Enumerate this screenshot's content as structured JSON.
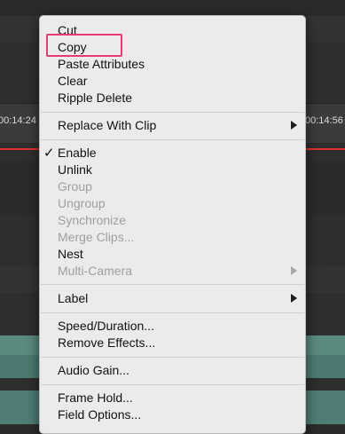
{
  "timeline": {
    "timecode_left": "00:14:24",
    "timecode_right": "00:14:56"
  },
  "menu": {
    "items": [
      {
        "label": "Cut",
        "enabled": true
      },
      {
        "label": "Copy",
        "enabled": true,
        "highlighted": true
      },
      {
        "label": "Paste Attributes",
        "enabled": true
      },
      {
        "label": "Clear",
        "enabled": true
      },
      {
        "label": "Ripple Delete",
        "enabled": true
      },
      {
        "label": "Replace With Clip",
        "enabled": true,
        "submenu": true
      },
      {
        "label": "Enable",
        "enabled": true,
        "checked": true
      },
      {
        "label": "Unlink",
        "enabled": true
      },
      {
        "label": "Group",
        "enabled": false
      },
      {
        "label": "Ungroup",
        "enabled": false
      },
      {
        "label": "Synchronize",
        "enabled": false
      },
      {
        "label": "Merge Clips...",
        "enabled": false
      },
      {
        "label": "Nest",
        "enabled": true
      },
      {
        "label": "Multi-Camera",
        "enabled": false,
        "submenu": true
      },
      {
        "label": "Label",
        "enabled": true,
        "submenu": true
      },
      {
        "label": "Speed/Duration...",
        "enabled": true
      },
      {
        "label": "Remove Effects...",
        "enabled": true
      },
      {
        "label": "Audio Gain...",
        "enabled": true
      },
      {
        "label": "Frame Hold...",
        "enabled": true
      },
      {
        "label": "Field Options...",
        "enabled": true
      }
    ]
  },
  "colors": {
    "highlight_border": "#e83a70",
    "menu_bg": "#ebebeb",
    "disabled_text": "#9f9f9f"
  }
}
